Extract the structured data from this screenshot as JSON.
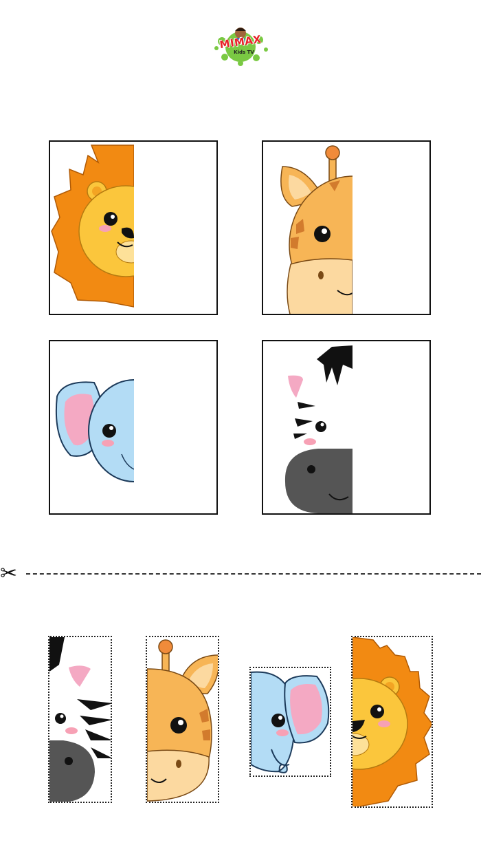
{
  "logo": {
    "brand": "MIMAX",
    "sub": "Kids TV",
    "colors": {
      "splash": "#7ac943",
      "text": "#e8232a"
    }
  },
  "puzzle": {
    "targets": [
      {
        "animal": "lion",
        "half": "left"
      },
      {
        "animal": "giraffe",
        "half": "left"
      },
      {
        "animal": "elephant",
        "half": "left"
      },
      {
        "animal": "zebra",
        "half": "left"
      }
    ],
    "pieces": [
      {
        "animal": "zebra",
        "half": "right"
      },
      {
        "animal": "giraffe",
        "half": "right"
      },
      {
        "animal": "elephant",
        "half": "right"
      },
      {
        "animal": "lion",
        "half": "right"
      }
    ]
  },
  "cut_line": {
    "icon": "scissors-icon",
    "glyph": "✂"
  },
  "colors": {
    "lion_mane": "#f28a12",
    "lion_face": "#fbc63c",
    "giraffe": "#f7b556",
    "giraffe_muzzle": "#fcd9a0",
    "elephant": "#b3dcf5",
    "elephant_ear": "#f4a9c3",
    "zebra_muzzle": "#555555",
    "blush": "#f7a1b5"
  }
}
